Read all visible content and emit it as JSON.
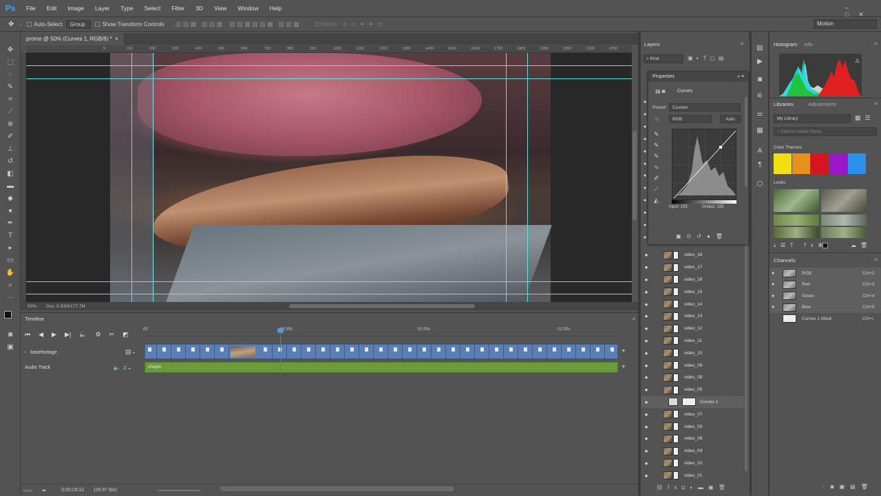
{
  "menubar": {
    "logo": "Ps",
    "items": [
      "File",
      "Edit",
      "Image",
      "Layer",
      "Type",
      "Select",
      "Filter",
      "3D",
      "View",
      "Window",
      "Help"
    ]
  },
  "options": {
    "auto_select": "Auto-Select",
    "group": "Group",
    "show_transform": "Show Transform Controls",
    "mode_3d": "3D Mode:",
    "workspace": "Motion"
  },
  "document": {
    "tab": "promo @ 50% (Curves 1, RGB/8) *",
    "close": "×",
    "zoom": "50%",
    "doc_info": "Doc: 5.93M/177.7M",
    "ruler_h": [
      "0",
      "100",
      "200",
      "300",
      "400",
      "500",
      "600",
      "700",
      "800",
      "900",
      "1000",
      "1100",
      "1200",
      "1300",
      "1400",
      "1500",
      "1600",
      "1700",
      "1800",
      "1900",
      "2000",
      "2100",
      "2200"
    ]
  },
  "timeline": {
    "title": "Timeline",
    "ruler": [
      "00",
      "00:30s",
      "01:00s",
      "01:30s"
    ],
    "video_track": "basefootage",
    "audio_track": "Audio Track",
    "audio_clip": "chopin",
    "timecode": "0;00;29;12",
    "fps": "(29.97 fps)"
  },
  "layers": {
    "tab": "Layers",
    "kind": "Kind",
    "rows": [
      "video_18",
      "video_17",
      "video_16",
      "video_15",
      "video_14",
      "video_13",
      "video_12",
      "video_11",
      "video_10",
      "video_09",
      "video_08",
      "video_05",
      "Curves 1",
      "video_07",
      "video_03",
      "video_06",
      "video_04",
      "video_02",
      "video_01"
    ]
  },
  "properties": {
    "tab": "Properties",
    "type": "Curves",
    "preset_label": "Preset:",
    "preset": "Custom",
    "channel": "RGB",
    "auto": "Auto",
    "input_label": "Input:",
    "input": "193",
    "output_label": "Output:",
    "output": "193"
  },
  "histogram": {
    "tab": "Histogram",
    "info": "Info"
  },
  "libraries": {
    "tab": "Libraries",
    "adjustments": "Adjustments",
    "library": "My Library",
    "search": "Search Adobe Stock",
    "color_themes": "Color Themes",
    "looks": "Looks",
    "swatches": [
      "#f0e010",
      "#e8901c",
      "#d8141e",
      "#9a18c8",
      "#2890e8"
    ]
  },
  "channels": {
    "tab": "Channels",
    "rows": [
      {
        "name": "RGB",
        "key": "Ctrl+2"
      },
      {
        "name": "Red",
        "key": "Ctrl+3"
      },
      {
        "name": "Green",
        "key": "Ctrl+4"
      },
      {
        "name": "Blue",
        "key": "Ctrl+5"
      },
      {
        "name": "Curves 1 Mask",
        "key": "Ctrl+\\"
      }
    ]
  }
}
